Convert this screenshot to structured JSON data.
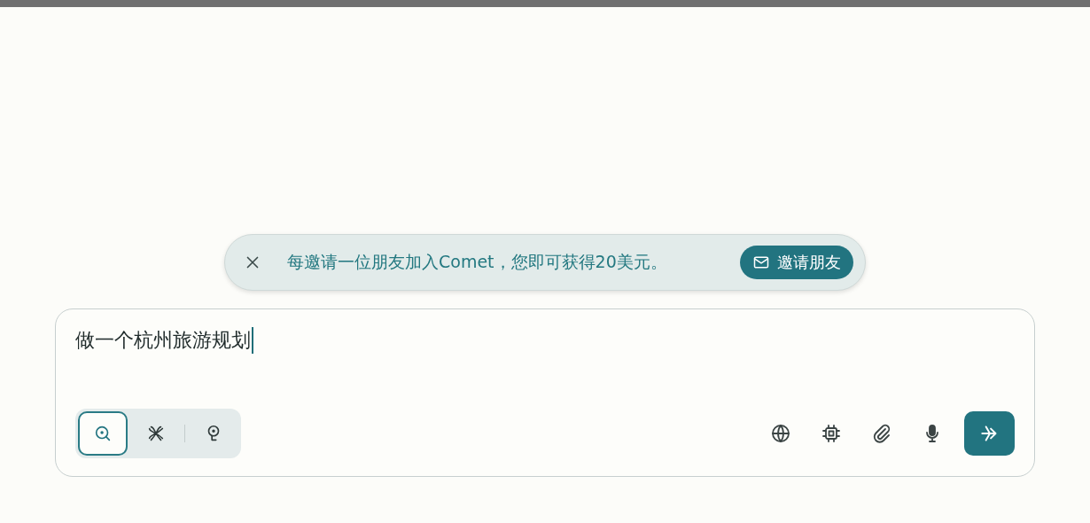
{
  "banner": {
    "message": "每邀请一位朋友加入Comet，您即可获得20美元。",
    "button": "邀请朋友"
  },
  "query": {
    "value": "做一个杭州旅游规划"
  },
  "modes": [
    {
      "kind": "search",
      "selected": true
    },
    {
      "kind": "research",
      "selected": false
    },
    {
      "kind": "labs",
      "selected": false
    }
  ],
  "tools": [
    {
      "kind": "globe"
    },
    {
      "kind": "chip"
    },
    {
      "kind": "attach"
    },
    {
      "kind": "mic"
    }
  ]
}
